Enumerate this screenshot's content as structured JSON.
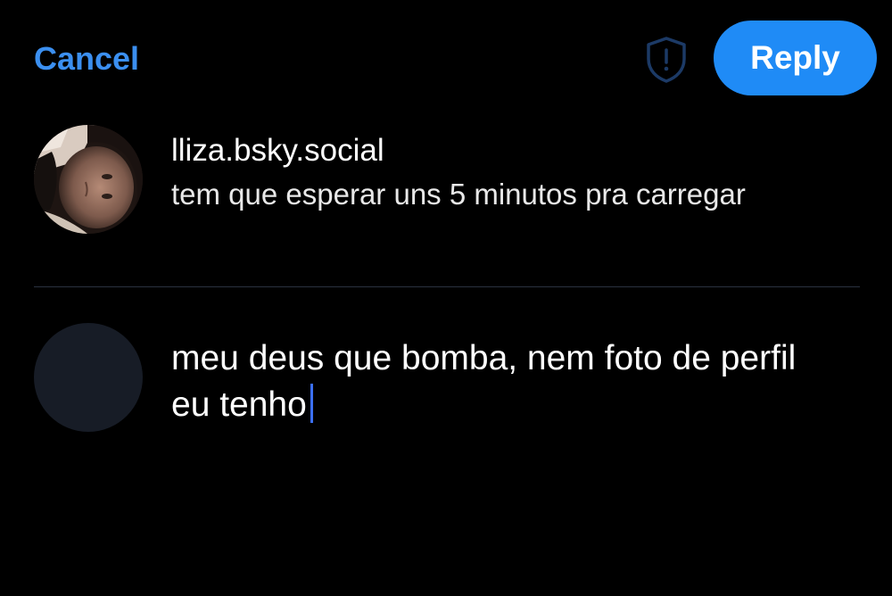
{
  "header": {
    "cancel_label": "Cancel",
    "reply_label": "Reply",
    "shield_icon": "shield-alert-icon"
  },
  "parent_post": {
    "handle": "lliza.bsky.social",
    "text": "tem que esperar uns 5 minutos pra carregar"
  },
  "composer": {
    "text": "meu deus que bomba, nem foto de perfil eu tenho"
  },
  "colors": {
    "accent": "#1f8bf6",
    "link": "#3b8ff0",
    "background": "#000000",
    "divider": "#2a3140",
    "empty_avatar": "#171c26",
    "caret": "#3b6ff5"
  }
}
